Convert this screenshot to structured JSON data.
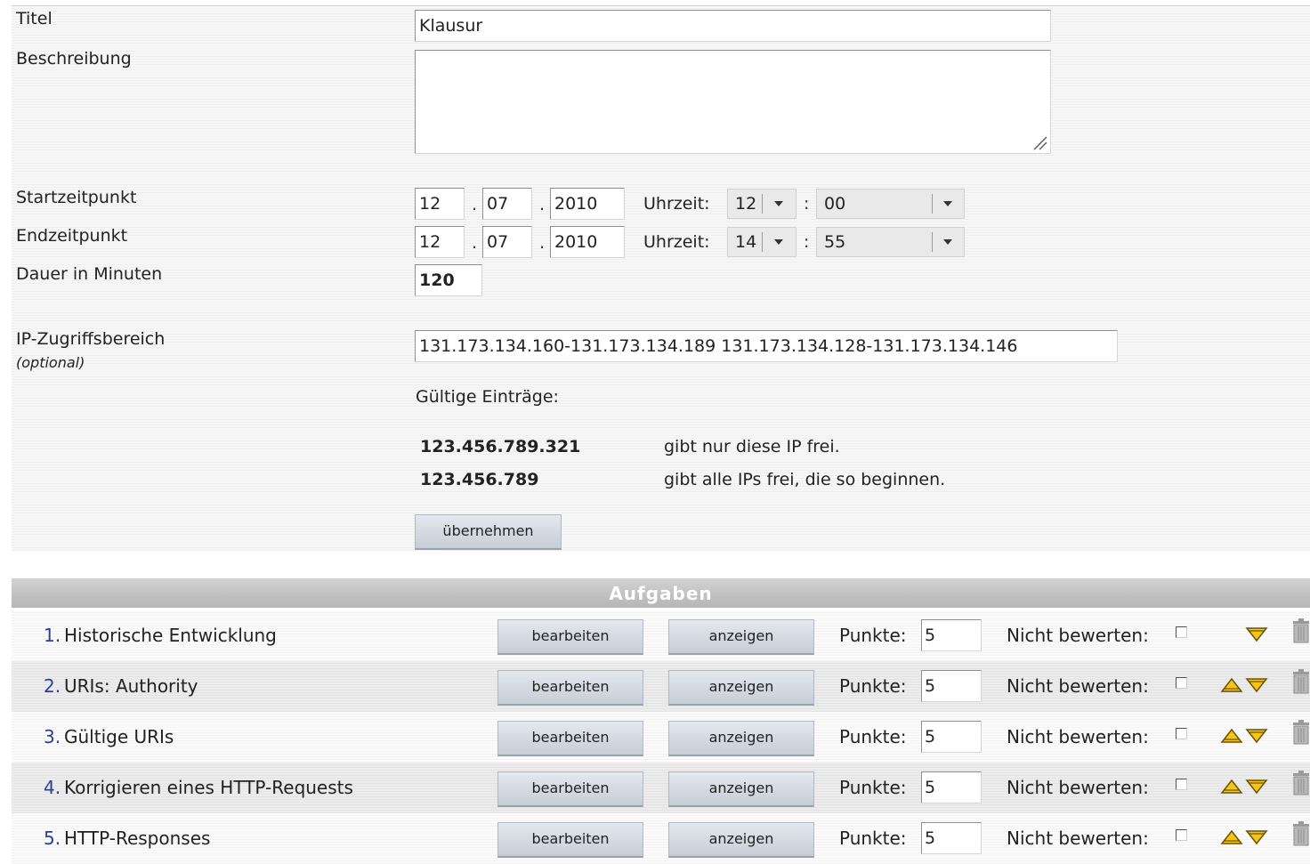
{
  "form": {
    "title_label": "Titel",
    "title_value": "Klausur",
    "description_label": "Beschreibung",
    "description_value": "",
    "start": {
      "label": "Startzeitpunkt",
      "day": "12",
      "month": "07",
      "year": "2010",
      "time_label": "Uhrzeit:",
      "hour": "12",
      "minute": "00"
    },
    "end": {
      "label": "Endzeitpunkt",
      "day": "12",
      "month": "07",
      "year": "2010",
      "time_label": "Uhrzeit:",
      "hour": "14",
      "minute": "55"
    },
    "date_separator": ".",
    "time_separator": ":",
    "duration_label": "Dauer in Minuten",
    "duration_value": "120",
    "ip_label": "IP-Zugriffsbereich",
    "ip_sublabel": "(optional)",
    "ip_value": "131.173.134.160-131.173.134.189 131.173.134.128-131.173.134.146",
    "valid_entries_label": "Gültige Einträge:",
    "examples": [
      {
        "ip": "123.456.789.321",
        "text": "gibt nur diese IP frei."
      },
      {
        "ip": "123.456.789",
        "text": "gibt alle IPs frei, die so beginnen."
      }
    ],
    "apply_label": "übernehmen"
  },
  "tasks": {
    "header": "Aufgaben",
    "edit_label": "bearbeiten",
    "show_label": "anzeigen",
    "points_label": "Punkte:",
    "no_grade_label": "Nicht bewerten:",
    "items": [
      {
        "num": "1.",
        "title": "Historische Entwicklung",
        "points": "5"
      },
      {
        "num": "2.",
        "title": "URIs: Authority",
        "points": "5"
      },
      {
        "num": "3.",
        "title": "Gültige URIs",
        "points": "5"
      },
      {
        "num": "4.",
        "title": "Korrigieren eines HTTP-Requests",
        "points": "5"
      },
      {
        "num": "5.",
        "title": "HTTP-Responses",
        "points": "5"
      }
    ]
  },
  "colors": {
    "accent_number": "#2a3f9a",
    "arrow_fill": "#f5c518",
    "header_text": "#ffffff"
  },
  "icons": {
    "move_up": "triangle-up-icon",
    "move_down": "triangle-down-icon",
    "delete": "trash-icon"
  }
}
